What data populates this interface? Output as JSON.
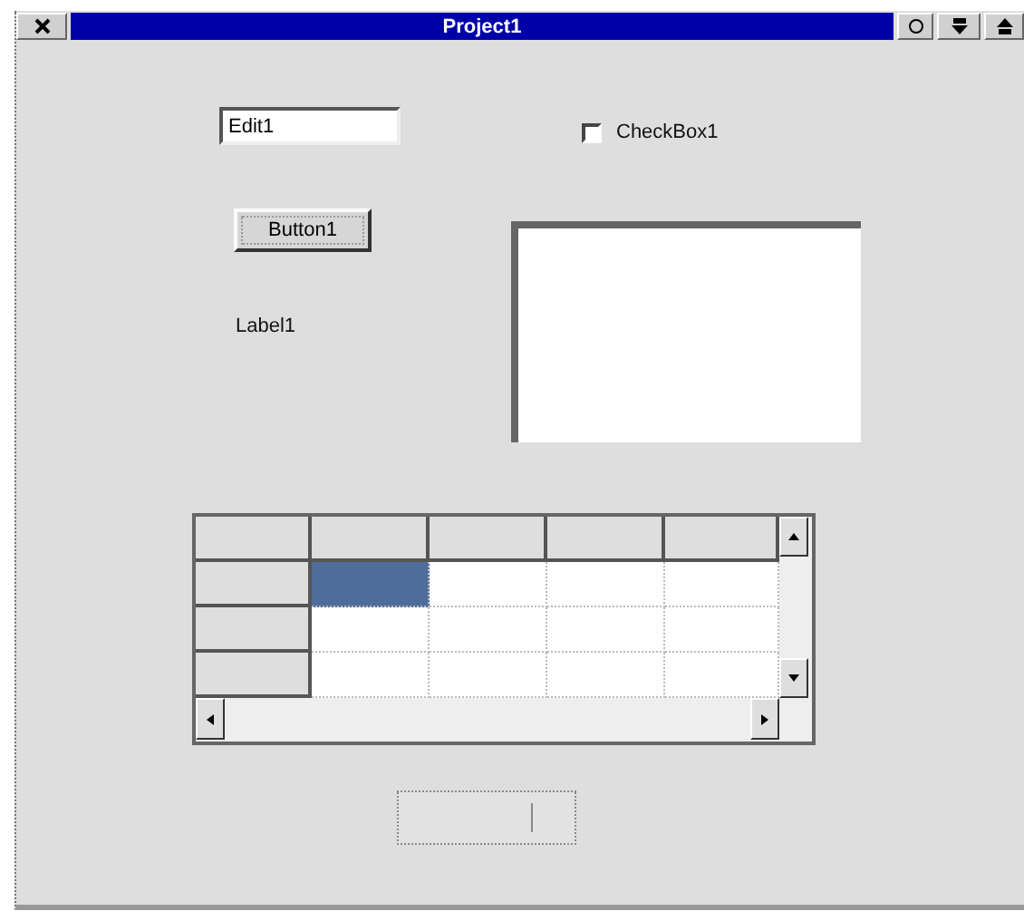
{
  "window": {
    "title": "Project1"
  },
  "edit": {
    "value": "Edit1"
  },
  "checkbox": {
    "label": "CheckBox1",
    "checked": false
  },
  "button": {
    "label": "Button1"
  },
  "label": {
    "text": "Label1"
  },
  "grid": {
    "rows": [
      {
        "cells": [
          {
            "selected": true
          },
          {
            "selected": false
          },
          {
            "selected": false
          },
          {
            "selected": false
          }
        ]
      },
      {
        "cells": [
          {
            "selected": false
          },
          {
            "selected": false
          },
          {
            "selected": false
          },
          {
            "selected": false
          }
        ]
      },
      {
        "cells": [
          {
            "selected": false
          },
          {
            "selected": false
          },
          {
            "selected": false
          },
          {
            "selected": false
          }
        ]
      }
    ]
  }
}
